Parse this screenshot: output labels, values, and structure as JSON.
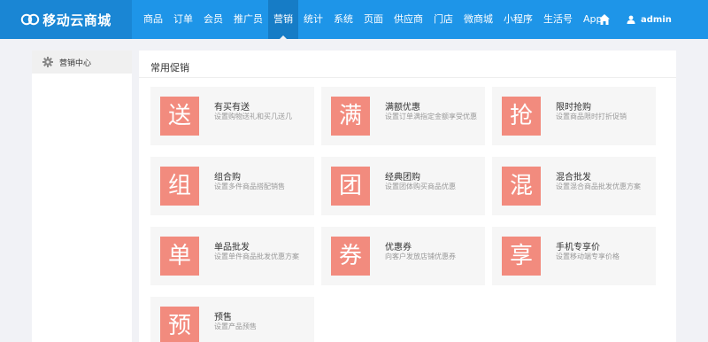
{
  "brand": {
    "name": "移动云商城"
  },
  "nav": {
    "items": [
      "商品",
      "订单",
      "会员",
      "推广员",
      "营销",
      "统计",
      "系统",
      "页面",
      "供应商",
      "门店",
      "微商城",
      "小程序",
      "生活号",
      "App"
    ],
    "active_index": 4
  },
  "user": {
    "name": "admin"
  },
  "sidebar": {
    "items": [
      {
        "label": "营销中心"
      }
    ]
  },
  "main": {
    "title": "常用促销",
    "cards": [
      {
        "icon_char": "送",
        "title": "有买有送",
        "desc": "设置购物送礼和买几送几"
      },
      {
        "icon_char": "满",
        "title": "满额优惠",
        "desc": "设置订单满指定金额享受优惠"
      },
      {
        "icon_char": "抢",
        "title": "限时抢购",
        "desc": "设置商品限时打折促销"
      },
      {
        "icon_char": "组",
        "title": "组合购",
        "desc": "设置多件商品搭配销售"
      },
      {
        "icon_char": "团",
        "title": "经典团购",
        "desc": "设置团体购买商品优惠"
      },
      {
        "icon_char": "混",
        "title": "混合批发",
        "desc": "设置混合商品批发优惠方案"
      },
      {
        "icon_char": "单",
        "title": "单品批发",
        "desc": "设置单件商品批发优惠方案"
      },
      {
        "icon_char": "券",
        "title": "优惠券",
        "desc": "向客户发放店铺优惠券"
      },
      {
        "icon_char": "享",
        "title": "手机专享价",
        "desc": "设置移动端专享价格"
      },
      {
        "icon_char": "预",
        "title": "预售",
        "desc": "设置产品预售"
      }
    ]
  },
  "colors": {
    "header": "#1e95e8",
    "logo_bg": "#1a86d4",
    "active_nav": "#167cc6",
    "card_icon": "#f28b7e",
    "page_bg": "#f1f2f6"
  }
}
